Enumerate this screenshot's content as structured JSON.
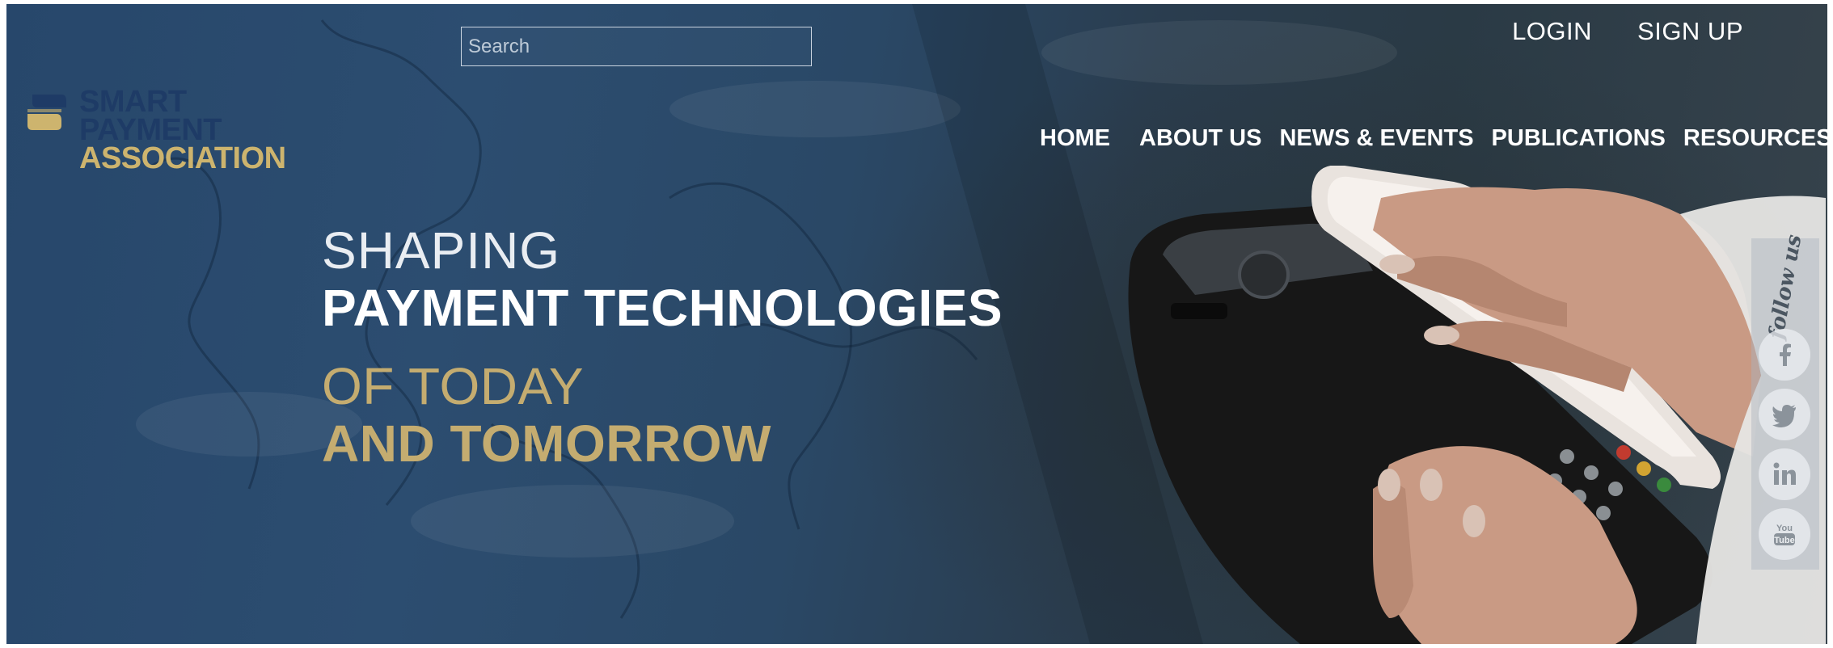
{
  "search": {
    "placeholder": "Search",
    "value": ""
  },
  "logo": {
    "line1": "SMART",
    "line2": "PAYMENT",
    "line3": "ASSOCIATION"
  },
  "auth": {
    "login": "LOGIN",
    "signup": "SIGN UP"
  },
  "nav": [
    {
      "label": "HOME"
    },
    {
      "label": "ABOUT US"
    },
    {
      "label": "NEWS & EVENTS"
    },
    {
      "label": "PUBLICATIONS"
    },
    {
      "label": "RESOURCES"
    }
  ],
  "headline": {
    "line1": "SHAPING",
    "line2": "PAYMENT TECHNOLOGIES",
    "line3": "OF TODAY",
    "line4": "AND TOMORROW"
  },
  "follow": {
    "label": "follow us",
    "icons": [
      "facebook-icon",
      "twitter-icon",
      "linkedin-icon",
      "youtube-icon"
    ]
  },
  "colors": {
    "brand_navy": "#1e3b66",
    "brand_gold": "#cdb46e",
    "headline_gold": "#c4ac70"
  }
}
